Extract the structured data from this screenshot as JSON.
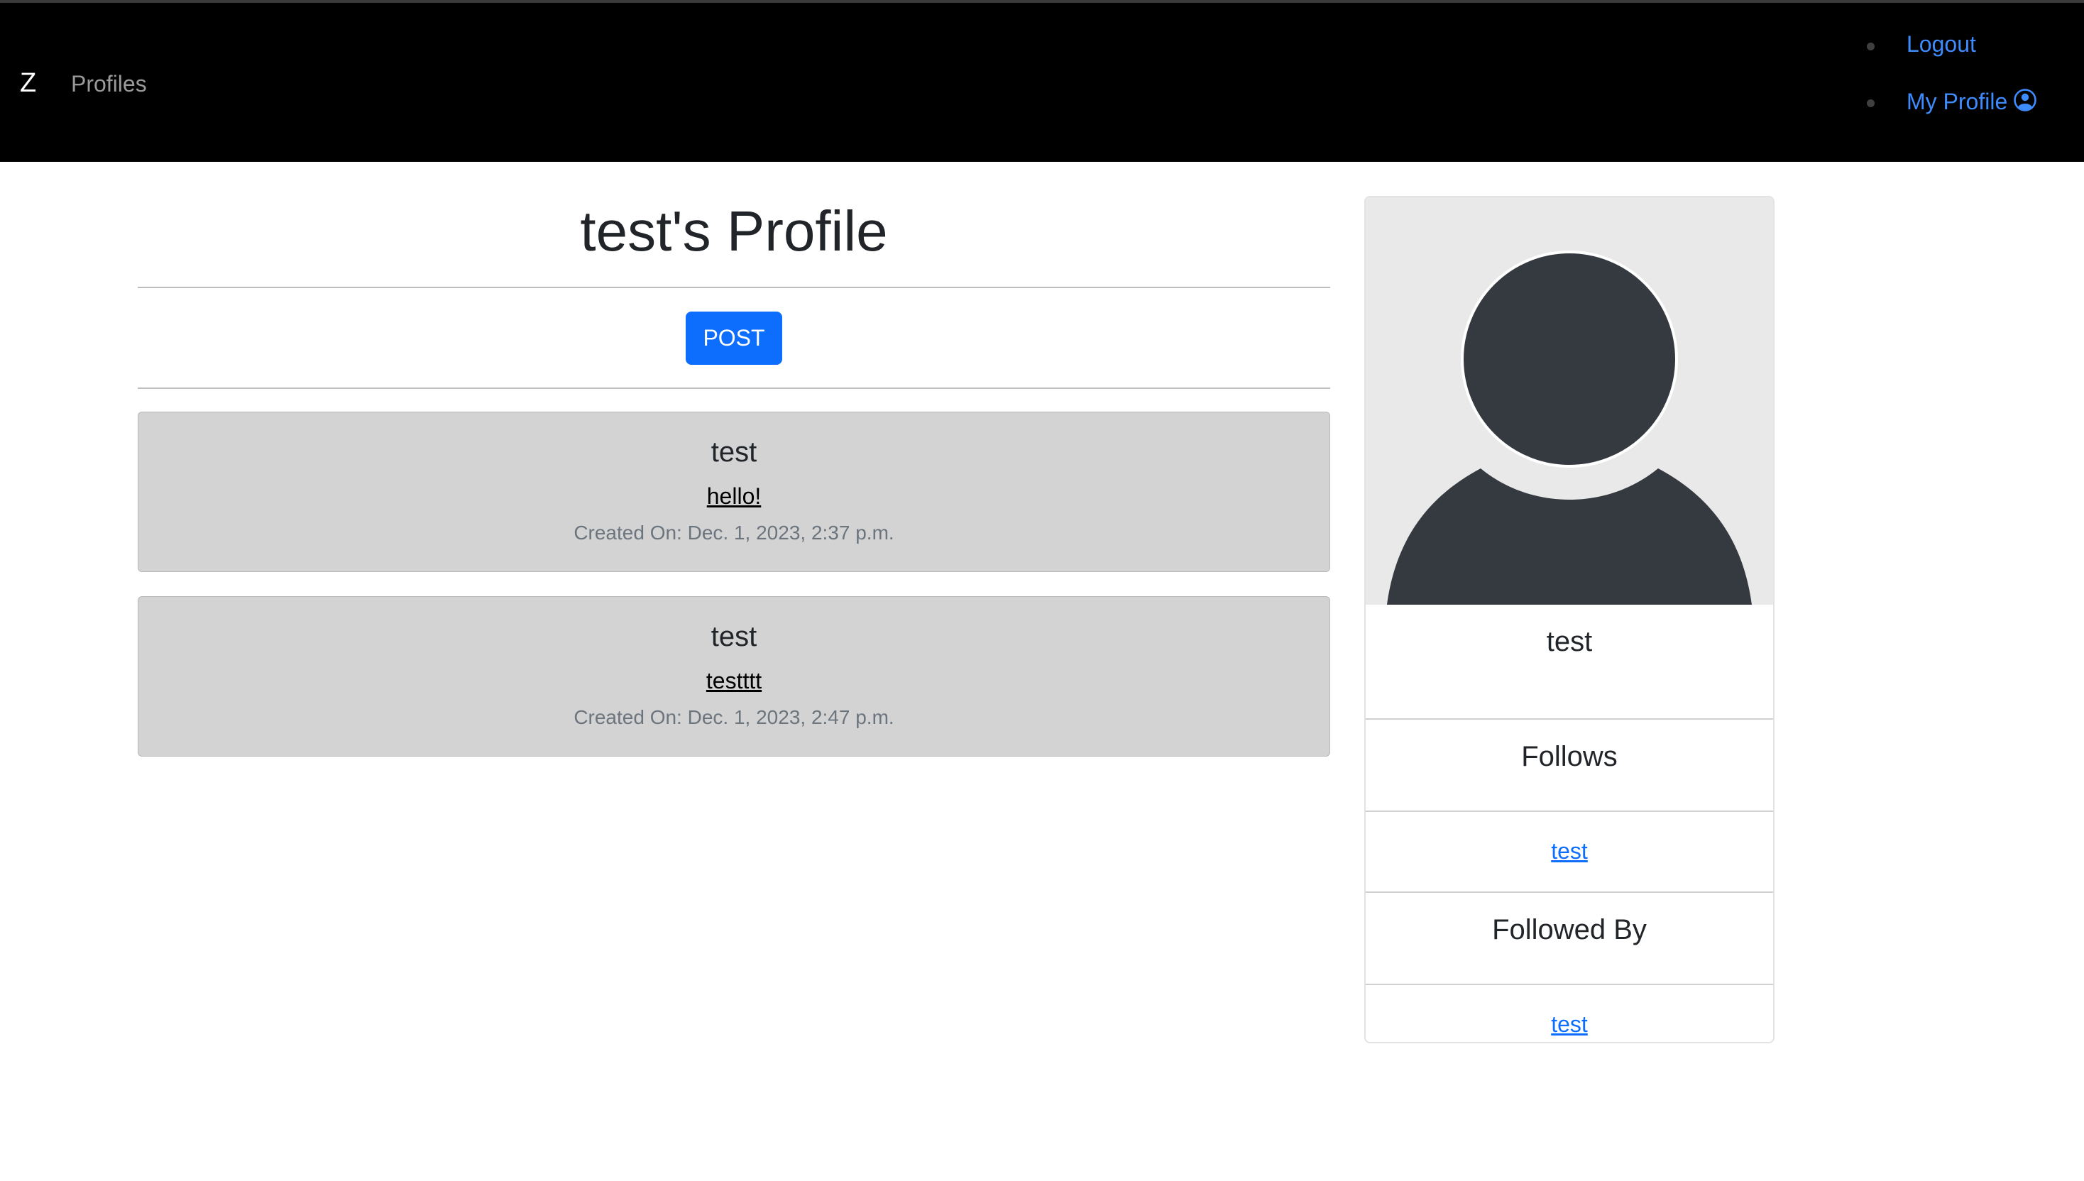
{
  "nav": {
    "brand": "Z",
    "profiles_label": "Profiles",
    "logout_label": "Logout",
    "my_profile_label": "My Profile",
    "link_color": "#3d8bfd",
    "background": "#000000"
  },
  "main": {
    "title": "test's Profile",
    "post_button_label": "POST",
    "posts": [
      {
        "author": "test",
        "content": "hello!",
        "created": "Created On: Dec. 1, 2023, 2:37 p.m."
      },
      {
        "author": "test",
        "content": "testttt",
        "created": "Created On: Dec. 1, 2023, 2:47 p.m."
      }
    ]
  },
  "sidebar": {
    "avatar_icon": "user-silhouette-icon",
    "username": "test",
    "follows_heading": "Follows",
    "follows": [
      "test"
    ],
    "followed_by_heading": "Followed By",
    "followed_by": [
      "test"
    ]
  },
  "colors": {
    "accent": "#0d6efd",
    "post_bg": "#d3d3d3",
    "avatar_bg": "#e9e9e9",
    "avatar_fg": "#343a40"
  }
}
